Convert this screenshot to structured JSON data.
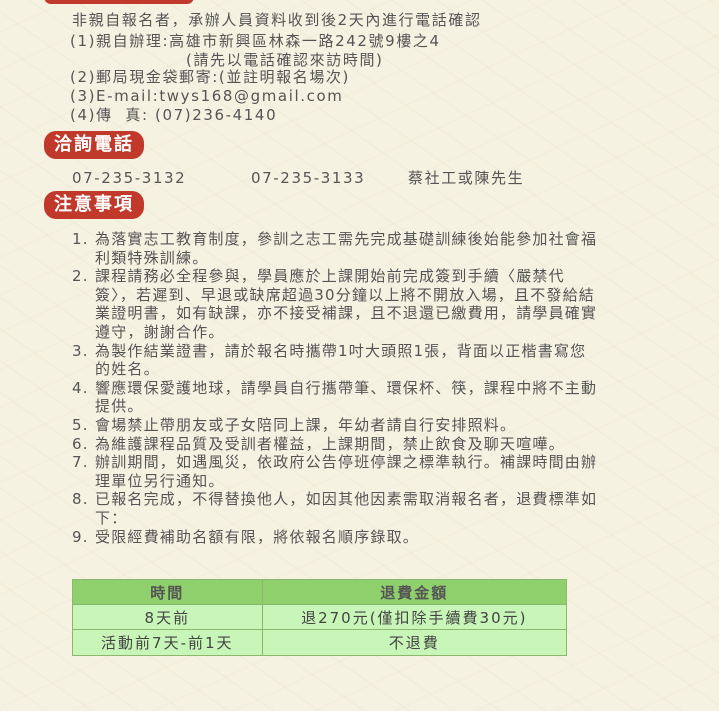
{
  "registration": {
    "intro": "非親自報名者，承辦人員資料收到後2天內進行電話確認",
    "method1": "(1)親自辦理:高雄市新興區林森一路242號9樓之4",
    "method1_note": "(請先以電話確認來訪時間)",
    "method2": "(2)郵局現金袋郵寄:(並註明報名場次)",
    "method3": "(3)E-mail:twys168@gmail.com",
    "method4": "(4)傳  真: (07)236-4140"
  },
  "inquiry": {
    "heading": "洽詢電話",
    "phone1": "07-235-3132",
    "phone2": "07-235-3133",
    "contact": "蔡社工或陳先生"
  },
  "notes": {
    "heading": "注意事項",
    "items": [
      {
        "num": "1.",
        "text": "為落實志工教育制度，參訓之志工需先完成基礎訓練後始能參加社會福利類特殊訓練。"
      },
      {
        "num": "2.",
        "text": "課程請務必全程參與，學員應於上課開始前完成簽到手續〈嚴禁代簽〉，若遲到、早退或缺席超過30分鐘以上將不開放入場，且不發給結業證明書，如有缺課，亦不接受補課，且不退還已繳費用，請學員確實遵守，謝謝合作。"
      },
      {
        "num": "3.",
        "text": "為製作結業證書，請於報名時攜帶1吋大頭照1張，背面以正楷書寫您的姓名。"
      },
      {
        "num": "4.",
        "text": "響應環保愛護地球，請學員自行攜帶筆、環保杯、筷，課程中將不主動提供。"
      },
      {
        "num": "5.",
        "text": "會場禁止帶朋友或子女陪同上課，年幼者請自行安排照料。"
      },
      {
        "num": "6.",
        "text": "為維護課程品質及受訓者權益，上課期間，禁止飲食及聊天喧嘩。"
      },
      {
        "num": "7.",
        "text": "辦訓期間，如遇風災，依政府公告停班停課之標準執行。補課時間由辦理單位另行通知。"
      },
      {
        "num": "8.",
        "text": "已報名完成，不得替換他人，如因其他因素需取消報名者，退費標準如下："
      },
      {
        "num": "9.",
        "text": "受限經費補助名額有限，將依報名順序錄取。"
      }
    ]
  },
  "refund_table": {
    "headers": [
      "時間",
      "退費金額"
    ],
    "rows": [
      [
        "8天前",
        "退270元(僅扣除手續費30元)"
      ],
      [
        "活動前7天-前1天",
        "不退費"
      ]
    ]
  },
  "colors": {
    "badge": "#c0392b",
    "header_green": "#8fd06d",
    "cell_green": "#c8f5b8",
    "text": "#555555",
    "background": "#f6f2e2"
  }
}
